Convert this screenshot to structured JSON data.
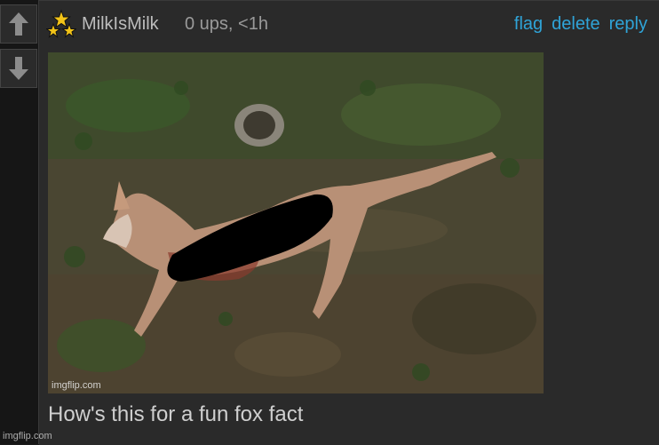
{
  "vote": {
    "up_icon": "arrow-up-icon",
    "down_icon": "arrow-down-icon"
  },
  "comment": {
    "avatar_icon": "stars-avatar-icon",
    "username": "MilkIsMilk",
    "meta": "0 ups, <1h",
    "actions": {
      "flag": "flag",
      "delete": "delete",
      "reply": "reply"
    },
    "image": {
      "watermark": "imgflip.com"
    },
    "caption": "How's this for a fun fox fact"
  },
  "footer": {
    "watermark": "imgflip.com"
  },
  "colors": {
    "link": "#2fa4d8",
    "background": "#2a2a2a",
    "star_gold": "#f2c318"
  }
}
